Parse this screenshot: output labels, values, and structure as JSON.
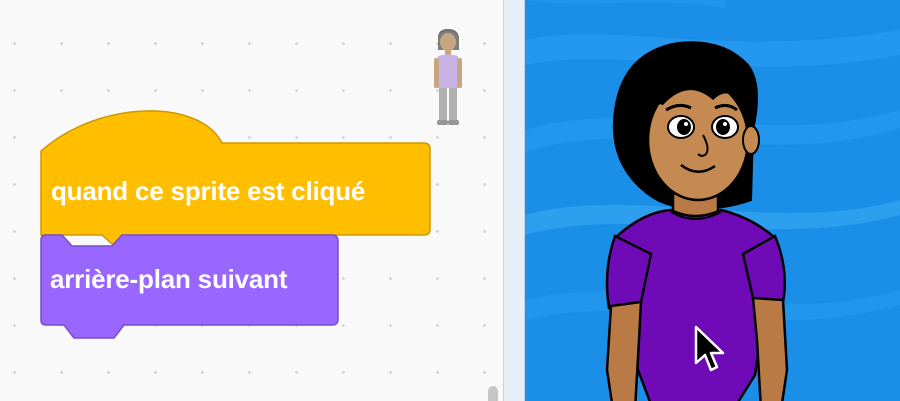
{
  "workspace": {
    "event_block": {
      "label": "quand ce sprite est cliqué",
      "color": "#FFBF00",
      "border": "#CC9900"
    },
    "looks_block": {
      "label": "arrière-plan suivant",
      "color": "#9966FF",
      "border": "#774DCB"
    },
    "sprite_thumbnail": "character-sprite"
  },
  "stage": {
    "backdrop_color": "#1B8FE8",
    "sprite": "character-sprite",
    "cursor": "arrow-cursor-icon"
  }
}
